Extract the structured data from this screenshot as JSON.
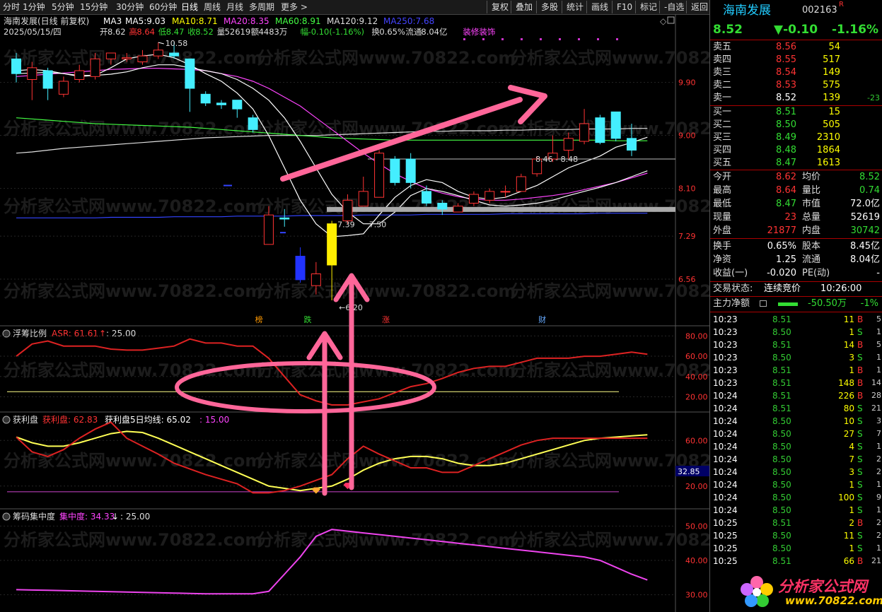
{
  "period_tabs": [
    "分时",
    "1分钟",
    "5分钟",
    "15分钟",
    "30分钟",
    "60分钟",
    "日线",
    "周线",
    "月线",
    "多周期",
    "更多 >"
  ],
  "toolbar": [
    "复权",
    "叠加",
    "多股",
    "统计",
    "画线",
    "F10",
    "标记",
    "-自选",
    "返回"
  ],
  "header": {
    "title": "海南发展(日线 前复权)",
    "ma": [
      {
        "label": "MA3",
        "value": "",
        "color": "#ffffff"
      },
      {
        "label": "MA5:",
        "value": "9.03",
        "color": "#ffffff"
      },
      {
        "label": "MA10:",
        "value": "8.71",
        "color": "#ffff00"
      },
      {
        "label": "MA20:",
        "value": "8.35",
        "color": "#ff44ff"
      },
      {
        "label": "MA60:",
        "value": "8.91",
        "color": "#44ff44"
      },
      {
        "label": "MA120:",
        "value": "9.12",
        "color": "#dddddd"
      },
      {
        "label": "MA250:",
        "value": "7.68",
        "color": "#4444ff"
      }
    ],
    "date": "2025/05/15/四",
    "open_lbl": "开",
    "open": "8.62",
    "high_lbl": "高",
    "high": "8.64",
    "low_lbl": "低",
    "low": "8.47",
    "close_lbl": "收",
    "close": "8.52",
    "vol_lbl": "量",
    "vol": "52619",
    "amt_lbl": "额",
    "amt": "4483万",
    "chg_lbl": "幅",
    "chg": "-0.10(-1.16%)",
    "turn_lbl": "换",
    "turn": "0.65%",
    "float_lbl": "流通",
    "float": "8.04亿",
    "sector": "装修装饰"
  },
  "price_axis": [
    "9.90",
    "9.00",
    "8.10",
    "7.29",
    "6.56"
  ],
  "annotations": {
    "high": "10.58",
    "low": "6.20",
    "p1": "7.39",
    "p2": "7.50",
    "p3": "8.46",
    "p4": "8.48"
  },
  "event_marks": [
    {
      "label": "榜",
      "color": "#ff9900"
    },
    {
      "label": "跌",
      "color": "#33dd33"
    },
    {
      "label": "涨",
      "color": "#ff3333"
    },
    {
      "label": "财",
      "color": "#66aaff"
    }
  ],
  "watermark": "分析家公式网www.70822.com",
  "panel1": {
    "title": "浮筹比例",
    "series": "ASR:",
    "series_value": "61.61",
    "ref": "25.00",
    "axis": [
      "80.00",
      "60.00",
      "40.00",
      "20.00"
    ]
  },
  "panel2": {
    "title": "获利盘",
    "series1": "获利盘:",
    "series1_value": "62.83",
    "series2": "获利盘5日均线:",
    "series2_value": "65.02",
    "ref": "15.00",
    "axis": [
      "60.00",
      "20.00"
    ],
    "cursor": "32.85"
  },
  "panel3": {
    "title": "筹码集中度",
    "series": "集中度:",
    "series_value": "34.33",
    "ref": "25.00",
    "axis": [
      "50.00",
      "40.00",
      "30.00"
    ]
  },
  "chart_data": {
    "type": "candlestick",
    "y_range": [
      6.2,
      10.58
    ],
    "candles": [
      {
        "o": 10.3,
        "c": 10.05,
        "h": 10.4,
        "l": 9.9
      },
      {
        "o": 9.95,
        "c": 10.15,
        "h": 10.25,
        "l": 9.6
      },
      {
        "o": 10.1,
        "c": 9.8,
        "h": 10.15,
        "l": 9.6
      },
      {
        "o": 9.7,
        "c": 9.92,
        "h": 10.0,
        "l": 9.65
      },
      {
        "o": 9.95,
        "c": 10.1,
        "h": 10.2,
        "l": 9.9
      },
      {
        "o": 10.0,
        "c": 10.3,
        "h": 10.4,
        "l": 9.95
      },
      {
        "o": 10.3,
        "c": 10.4,
        "h": 10.4,
        "l": 10.2
      },
      {
        "o": 10.3,
        "c": 10.32,
        "h": 10.4,
        "l": 10.25
      },
      {
        "o": 10.25,
        "c": 10.35,
        "h": 10.45,
        "l": 10.2
      },
      {
        "o": 10.35,
        "c": 10.45,
        "h": 10.58,
        "l": 10.3
      },
      {
        "o": 10.4,
        "c": 10.35,
        "h": 10.58,
        "l": 10.3
      },
      {
        "o": 10.3,
        "c": 9.8,
        "h": 10.3,
        "l": 9.4
      },
      {
        "o": 9.7,
        "c": 9.55,
        "h": 9.75,
        "l": 9.5
      },
      {
        "o": 9.55,
        "c": 9.52,
        "h": 9.6,
        "l": 9.45
      },
      {
        "o": 9.6,
        "c": 9.45,
        "h": 9.6,
        "l": 9.3
      },
      {
        "o": 9.3,
        "c": 9.1,
        "h": 9.35,
        "l": 9.05
      },
      {
        "o": 7.15,
        "c": 7.65,
        "h": 7.8,
        "l": 7.15
      },
      {
        "o": 7.6,
        "c": 7.58,
        "h": 7.75,
        "l": 7.45
      },
      {
        "o": 6.95,
        "c": 6.55,
        "h": 7.1,
        "l": 6.5
      },
      {
        "o": 6.45,
        "c": 6.65,
        "h": 6.85,
        "l": 6.3
      },
      {
        "o": 6.8,
        "c": 7.5,
        "h": 7.55,
        "l": 6.2
      },
      {
        "o": 7.55,
        "c": 7.9,
        "h": 8.0,
        "l": 7.5
      },
      {
        "o": 7.8,
        "c": 8.05,
        "h": 8.3,
        "l": 7.8
      },
      {
        "o": 7.95,
        "c": 8.7,
        "h": 8.75,
        "l": 7.95
      },
      {
        "o": 8.6,
        "c": 8.2,
        "h": 8.65,
        "l": 8.15
      },
      {
        "o": 8.6,
        "c": 8.2,
        "h": 8.7,
        "l": 8.1
      },
      {
        "o": 8.05,
        "c": 7.85,
        "h": 8.15,
        "l": 7.8
      },
      {
        "o": 7.85,
        "c": 7.75,
        "h": 7.9,
        "l": 7.65
      },
      {
        "o": 7.7,
        "c": 7.8,
        "h": 7.85,
        "l": 7.7
      },
      {
        "o": 7.85,
        "c": 8.0,
        "h": 8.05,
        "l": 7.8
      },
      {
        "o": 7.9,
        "c": 8.05,
        "h": 8.1,
        "l": 7.85
      },
      {
        "o": 8.05,
        "c": 8.05,
        "h": 8.15,
        "l": 7.95
      },
      {
        "o": 8.05,
        "c": 8.3,
        "h": 8.35,
        "l": 8.05
      },
      {
        "o": 8.35,
        "c": 8.6,
        "h": 8.65,
        "l": 8.3
      },
      {
        "o": 8.6,
        "c": 8.7,
        "h": 9.0,
        "l": 8.55
      },
      {
        "o": 8.75,
        "c": 8.95,
        "h": 9.05,
        "l": 8.6
      },
      {
        "o": 8.9,
        "c": 9.2,
        "h": 9.45,
        "l": 8.85
      },
      {
        "o": 9.3,
        "c": 8.88,
        "h": 9.35,
        "l": 8.85
      },
      {
        "o": 9.4,
        "c": 8.95,
        "h": 9.4,
        "l": 8.9
      },
      {
        "o": 8.95,
        "c": 8.75,
        "h": 9.2,
        "l": 8.65
      }
    ],
    "ma5": [
      10.1,
      10.12,
      10.1,
      10.05,
      10.0,
      10.02,
      10.15,
      10.3,
      10.35,
      10.38,
      10.32,
      10.2,
      10.05,
      9.92,
      9.72,
      9.45,
      9.0,
      8.45,
      7.9,
      7.5,
      7.28,
      7.3,
      7.33,
      7.65,
      7.95,
      8.15,
      8.25,
      8.2,
      8.05,
      7.95,
      7.92,
      7.95,
      8.05,
      8.15,
      8.3,
      8.45,
      8.55,
      8.65,
      8.8,
      8.88,
      8.97
    ],
    "ma10": [
      10.05,
      10.06,
      10.07,
      10.05,
      10.02,
      10.02,
      10.04,
      10.08,
      10.15,
      10.2,
      10.2,
      10.15,
      10.1,
      10.05,
      9.95,
      9.8,
      9.6,
      9.3,
      8.9,
      8.45,
      8.0,
      7.7,
      7.5,
      7.5,
      7.7,
      7.98,
      8.1,
      8.05,
      7.98,
      7.9,
      7.82,
      7.8,
      7.82,
      7.85,
      7.9,
      7.98,
      8.05,
      8.12,
      8.2,
      8.3,
      8.4
    ],
    "ma20": [
      10.0,
      10.02,
      10.04,
      10.06,
      10.08,
      10.1,
      10.12,
      10.13,
      10.14,
      10.14,
      10.13,
      10.12,
      10.1,
      10.05,
      10.0,
      9.92,
      9.8,
      9.65,
      9.5,
      9.3,
      9.1,
      8.9,
      8.7,
      8.52,
      8.35,
      8.22,
      8.1,
      8.02,
      7.96,
      7.92,
      7.9,
      7.9,
      7.92,
      7.95,
      7.98,
      8.02,
      8.08,
      8.14,
      8.2,
      8.28,
      8.36
    ],
    "ma60": [
      9.3,
      9.28,
      9.26,
      9.24,
      9.22,
      9.2,
      9.19,
      9.18,
      9.17,
      9.16,
      9.15,
      9.14,
      9.12,
      9.1,
      9.08,
      9.06,
      9.04,
      9.02,
      9.0,
      8.98,
      8.96,
      8.95,
      8.94,
      8.93,
      8.92,
      8.92,
      8.92,
      8.92,
      8.92,
      8.92,
      8.92,
      8.92,
      8.92,
      8.92,
      8.92,
      8.92,
      8.92,
      8.92,
      8.91,
      8.91,
      8.91
    ],
    "ma120": [
      8.7,
      8.72,
      8.75,
      8.78,
      8.8,
      8.82,
      8.84,
      8.86,
      8.88,
      8.9,
      8.92,
      8.94,
      8.96,
      8.97,
      8.98,
      8.99,
      9.0,
      9.0,
      9.0,
      9.0,
      9.01,
      9.02,
      9.03,
      9.04,
      9.05,
      9.06,
      9.07,
      9.07,
      9.08,
      9.08,
      9.08,
      9.09,
      9.09,
      9.1,
      9.1,
      9.1,
      9.11,
      9.11,
      9.11,
      9.12,
      9.12
    ],
    "ma250": [
      7.6,
      7.6,
      7.6,
      7.6,
      7.6,
      7.6,
      7.61,
      7.61,
      7.61,
      7.61,
      7.62,
      7.62,
      7.62,
      7.62,
      7.63,
      7.63,
      7.63,
      7.63,
      7.64,
      7.64,
      7.64,
      7.64,
      7.65,
      7.65,
      7.65,
      7.65,
      7.66,
      7.66,
      7.66,
      7.66,
      7.66,
      7.67,
      7.67,
      7.67,
      7.67,
      7.67,
      7.67,
      7.68,
      7.68,
      7.68,
      7.68
    ],
    "asr": [
      60,
      72,
      75,
      70,
      70,
      70,
      67,
      66,
      66,
      68,
      70,
      77,
      73,
      73,
      70,
      70,
      58,
      40,
      22,
      16,
      12,
      12,
      15,
      18,
      24,
      30,
      33,
      38,
      44,
      48,
      50,
      50,
      54,
      58,
      58,
      58,
      60,
      60,
      62,
      64,
      62
    ],
    "asr_range": [
      5,
      90
    ],
    "profit": [
      63,
      50,
      46,
      52,
      62,
      70,
      76,
      62,
      55,
      48,
      40,
      35,
      30,
      26,
      22,
      14,
      14,
      16,
      20,
      25,
      30,
      44,
      55,
      48,
      42,
      36,
      36,
      32,
      32,
      38,
      44,
      50,
      56,
      60,
      62,
      62,
      62,
      62,
      62,
      62,
      62
    ],
    "profit_ma5": [
      63,
      58,
      55,
      55,
      58,
      62,
      66,
      68,
      67,
      62,
      56,
      50,
      44,
      38,
      32,
      26,
      20,
      18,
      16,
      18,
      20,
      26,
      34,
      40,
      44,
      46,
      46,
      44,
      40,
      38,
      38,
      40,
      44,
      48,
      52,
      56,
      60,
      62,
      63,
      64,
      65
    ],
    "profit_range": [
      0,
      85
    ],
    "conc": [
      31.5,
      31.4,
      31.3,
      31.2,
      31.1,
      31.0,
      30.9,
      30.8,
      30.7,
      30.6,
      30.5,
      30.4,
      30.3,
      30.3,
      30.3,
      30.3,
      31.0,
      36.0,
      41.0,
      47.0,
      49.0,
      48.5,
      48.0,
      47.5,
      47.0,
      46.5,
      46.0,
      45.5,
      45.0,
      44.5,
      44.0,
      43.5,
      43.0,
      42.5,
      42.0,
      41.5,
      41.0,
      40.0,
      38.0,
      36.0,
      34.3
    ],
    "conc_range": [
      25,
      55
    ]
  },
  "stock": {
    "name": "海南发展",
    "code": "002163",
    "badge": "R"
  },
  "quote": {
    "price": "8.52",
    "change": "▼-0.10",
    "pct": "-1.16%"
  },
  "sell": [
    {
      "label": "卖五",
      "price": "8.56",
      "vol": "54",
      "chg": ""
    },
    {
      "label": "卖四",
      "price": "8.55",
      "vol": "517",
      "chg": ""
    },
    {
      "label": "卖三",
      "price": "8.54",
      "vol": "149",
      "chg": ""
    },
    {
      "label": "卖二",
      "price": "8.53",
      "vol": "575",
      "chg": ""
    },
    {
      "label": "卖一",
      "price": "8.52",
      "vol": "139",
      "chg": "-23"
    }
  ],
  "buy": [
    {
      "label": "买一",
      "price": "8.51",
      "vol": "15"
    },
    {
      "label": "买二",
      "price": "8.50",
      "vol": "505"
    },
    {
      "label": "买三",
      "price": "8.49",
      "vol": "2310"
    },
    {
      "label": "买四",
      "price": "8.48",
      "vol": "1864"
    },
    {
      "label": "买五",
      "price": "8.47",
      "vol": "1613"
    }
  ],
  "stats": [
    {
      "l1": "今开",
      "v1": "8.62",
      "c1": "up",
      "l2": "均价",
      "v2": "8.52",
      "c2": "dn"
    },
    {
      "l1": "最高",
      "v1": "8.64",
      "c1": "up",
      "l2": "量比",
      "v2": "0.74",
      "c2": "dn"
    },
    {
      "l1": "最低",
      "v1": "8.47",
      "c1": "dn",
      "l2": "市值",
      "v2": "72.0亿",
      "c2": "wh"
    },
    {
      "l1": "现量",
      "v1": "23",
      "c1": "up",
      "l2": "总量",
      "v2": "52619",
      "c2": "wh"
    },
    {
      "l1": "外盘",
      "v1": "21877",
      "c1": "up",
      "l2": "内盘",
      "v2": "30742",
      "c2": "dn"
    },
    {
      "l1": "换手",
      "v1": "0.65%",
      "c1": "wh",
      "l2": "股本",
      "v2": "8.45亿",
      "c2": "wh"
    },
    {
      "l1": "净资",
      "v1": "1.25",
      "c1": "wh",
      "l2": "流通",
      "v2": "8.04亿",
      "c2": "wh"
    },
    {
      "l1": "收益(一)",
      "v1": "-0.020",
      "c1": "wh",
      "l2": "PE(动)",
      "v2": "-",
      "c2": "wh"
    }
  ],
  "trade_status": {
    "label": "交易状态:",
    "value": "连续竞价",
    "time": "10:26:00"
  },
  "capital": {
    "label": "主力净额",
    "value": "-50.50万",
    "pct": "-1%"
  },
  "ticks": [
    {
      "t": "10:23",
      "p": "8.51",
      "v": "11",
      "bs": "B",
      "n": "5"
    },
    {
      "t": "10:23",
      "p": "8.50",
      "v": "1",
      "bs": "S",
      "n": "1"
    },
    {
      "t": "10:23",
      "p": "8.51",
      "v": "14",
      "bs": "B",
      "n": "5"
    },
    {
      "t": "10:23",
      "p": "8.50",
      "v": "3",
      "bs": "S",
      "n": "1"
    },
    {
      "t": "10:23",
      "p": "8.51",
      "v": "1",
      "bs": "B",
      "n": "1"
    },
    {
      "t": "10:23",
      "p": "8.51",
      "v": "148",
      "bs": "B",
      "n": "14"
    },
    {
      "t": "10:24",
      "p": "8.51",
      "v": "226",
      "bs": "B",
      "n": "28"
    },
    {
      "t": "10:24",
      "p": "8.51",
      "v": "80",
      "bs": "S",
      "n": "21"
    },
    {
      "t": "10:24",
      "p": "8.50",
      "v": "10",
      "bs": "S",
      "n": "3"
    },
    {
      "t": "10:24",
      "p": "8.50",
      "v": "27",
      "bs": "S",
      "n": "7"
    },
    {
      "t": "10:24",
      "p": "8.50",
      "v": "4",
      "bs": "S",
      "n": "1"
    },
    {
      "t": "10:24",
      "p": "8.50",
      "v": "7",
      "bs": "S",
      "n": "2"
    },
    {
      "t": "10:24",
      "p": "8.50",
      "v": "3",
      "bs": "S",
      "n": "2"
    },
    {
      "t": "10:24",
      "p": "8.50",
      "v": "1",
      "bs": "S",
      "n": "1"
    },
    {
      "t": "10:24",
      "p": "8.50",
      "v": "100",
      "bs": "S",
      "n": "9"
    },
    {
      "t": "10:24",
      "p": "8.50",
      "v": "1",
      "bs": "S",
      "n": "1"
    },
    {
      "t": "10:25",
      "p": "8.51",
      "v": "2",
      "bs": "B",
      "n": "2"
    },
    {
      "t": "10:25",
      "p": "8.50",
      "v": "11",
      "bs": "S",
      "n": "2"
    },
    {
      "t": "10:25",
      "p": "8.50",
      "v": "1",
      "bs": "S",
      "n": "1"
    },
    {
      "t": "10:25",
      "p": "8.51",
      "v": "66",
      "bs": "B",
      "n": "21"
    }
  ],
  "logo": {
    "text": "分析家公式网",
    "url": "www.70822.com"
  }
}
